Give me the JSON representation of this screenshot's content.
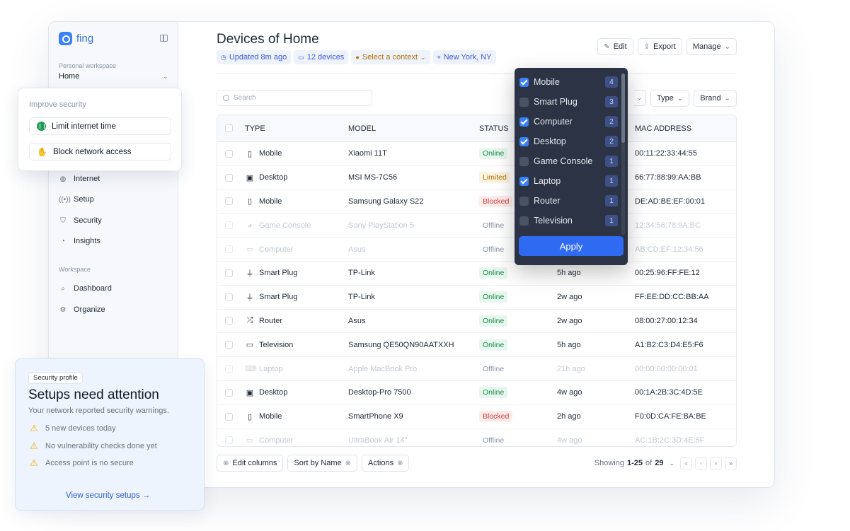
{
  "app": {
    "name": "fing"
  },
  "sidebar": {
    "workspace_label": "Personal workspace",
    "workspace_name": "Home",
    "items": [
      {
        "label": "Internet",
        "icon": "globe-icon"
      },
      {
        "label": "Setup",
        "icon": "signal-icon"
      },
      {
        "label": "Security",
        "icon": "shield-icon"
      },
      {
        "label": "Insights",
        "icon": "chart-icon"
      }
    ],
    "section_label": "Workspace",
    "workspace_items": [
      {
        "label": "Dashboard",
        "icon": "search-icon"
      },
      {
        "label": "Organize",
        "icon": "gear-icon"
      }
    ]
  },
  "header": {
    "title": "Devices of Home",
    "chips": [
      {
        "label": "Updated 8m ago",
        "icon": "clock-icon"
      },
      {
        "label": "12 devices",
        "icon": "monitor-icon"
      },
      {
        "label": "Select a context",
        "icon": "context-icon"
      },
      {
        "label": "New York, NY",
        "icon": "location-icon"
      }
    ],
    "actions": {
      "edit": "Edit",
      "export": "Export",
      "manage": "Manage"
    }
  },
  "search": {
    "placeholder": "Search"
  },
  "filters": {
    "type": "Type",
    "brand": "Brand"
  },
  "table": {
    "columns": [
      "TYPE",
      "MODEL",
      "STATUS",
      "",
      "MAC ADDRESS"
    ],
    "rows": [
      {
        "type": "Mobile",
        "icon": "mobile-icon",
        "model": "Xiaomi 11T",
        "status": "Online",
        "last_seen": "",
        "mac": "00:11:22:33:44:55",
        "faded": false
      },
      {
        "type": "Desktop",
        "icon": "desktop-icon",
        "model": "MSI MS-7C56",
        "status": "Limited",
        "last_seen": "",
        "mac": "66:77:88:99:AA:BB",
        "faded": false
      },
      {
        "type": "Mobile",
        "icon": "mobile-icon",
        "model": "Samsung Galaxy S22",
        "status": "Blocked",
        "last_seen": "",
        "mac": "DE:AD:BE:EF:00:01",
        "faded": false
      },
      {
        "type": "Game Console",
        "icon": "gamepad-icon",
        "model": "Sony PlayStation 5",
        "status": "Offline",
        "last_seen": "",
        "mac": "12:34:56:78:9A:BC",
        "faded": true
      },
      {
        "type": "Computer",
        "icon": "monitor-icon",
        "model": "Asus",
        "status": "Offline",
        "last_seen": "",
        "mac": "AB:CD:EF:12:34:56",
        "faded": true
      },
      {
        "type": "Smart Plug",
        "icon": "plug-icon",
        "model": "TP-Link",
        "status": "Online",
        "last_seen": "5h ago",
        "mac": "00:25:96:FF:FE:12",
        "faded": false
      },
      {
        "type": "Smart Plug",
        "icon": "plug-icon",
        "model": "TP-Link",
        "status": "Online",
        "last_seen": "2w ago",
        "mac": "FF:EE:DD:CC:BB:AA",
        "faded": false
      },
      {
        "type": "Router",
        "icon": "router-icon",
        "model": "Asus",
        "status": "Online",
        "last_seen": "2w ago",
        "mac": "08:00:27:00:12:34",
        "faded": false
      },
      {
        "type": "Television",
        "icon": "tv-icon",
        "model": "Samsung QE50QN90AATXXH",
        "status": "Online",
        "last_seen": "5h ago",
        "mac": "A1:B2:C3:D4:E5:F6",
        "faded": false
      },
      {
        "type": "Laptop",
        "icon": "laptop-icon",
        "model": "Apple MacBook Pro",
        "status": "Offline",
        "last_seen": "21h ago",
        "mac": "00:00:00:00:00:01",
        "faded": true
      },
      {
        "type": "Desktop",
        "icon": "desktop-icon",
        "model": "Desktop-Pro 7500",
        "status": "Online",
        "last_seen": "4w ago",
        "mac": "00:1A:2B:3C:4D:5E",
        "faded": false
      },
      {
        "type": "Mobile",
        "icon": "mobile-icon",
        "model": "SmartPhone X9",
        "status": "Blocked",
        "last_seen": "2h ago",
        "mac": "F0:0D:CA:FE:BA:BE",
        "faded": false
      },
      {
        "type": "Computer",
        "icon": "monitor-icon",
        "model": "UltraBook Air 14\"",
        "status": "Offline",
        "last_seen": "4w ago",
        "mac": "AC:1B:2C:3D:4E:5F",
        "faded": true
      }
    ]
  },
  "footer": {
    "edit_columns": "Edit columns",
    "sort": "Sort by Name",
    "actions": "Actions",
    "showing_prefix": "Showing",
    "range": "1-25",
    "of": "of",
    "total": "29"
  },
  "improve": {
    "title": "Improve security",
    "limit": "Limit internet time",
    "block": "Block network access"
  },
  "security_card": {
    "tag": "Security profile",
    "title": "Setups need attention",
    "subtitle": "Your network reported security warnings.",
    "items": [
      "5 new devices today",
      "No vulnerability checks done yet",
      "Access point is no secure"
    ],
    "link": "View security setups →"
  },
  "type_filter": {
    "options": [
      {
        "label": "Mobile",
        "count": "4",
        "checked": true
      },
      {
        "label": "Smart Plug",
        "count": "3",
        "checked": false
      },
      {
        "label": "Computer",
        "count": "2",
        "checked": true
      },
      {
        "label": "Desktop",
        "count": "2",
        "checked": true
      },
      {
        "label": "Game Console",
        "count": "1",
        "checked": false
      },
      {
        "label": "Laptop",
        "count": "1",
        "checked": true
      },
      {
        "label": "Router",
        "count": "1",
        "checked": false
      },
      {
        "label": "Television",
        "count": "1",
        "checked": false
      }
    ],
    "apply": "Apply"
  },
  "colors": {
    "accent": "#2f6bf2",
    "online": "#17884a",
    "blocked": "#d13b3b",
    "limited": "#b27300"
  }
}
